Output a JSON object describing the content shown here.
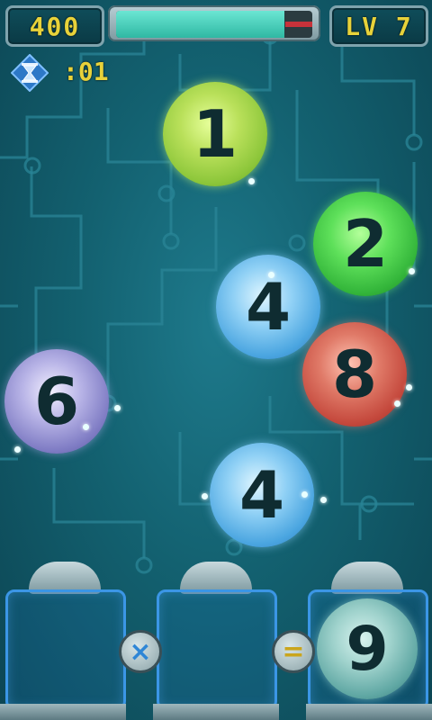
{
  "hud": {
    "score": "400",
    "level": "LV 7",
    "progress_fraction": 0.86
  },
  "timer": {
    "label": ":01",
    "icon": "hourglass-icon"
  },
  "bubbles": [
    {
      "number": "1",
      "color": "lime"
    },
    {
      "number": "2",
      "color": "green"
    },
    {
      "number": "4",
      "color": "blue"
    },
    {
      "number": "8",
      "color": "red"
    },
    {
      "number": "6",
      "color": "purple"
    },
    {
      "number": "4",
      "color": "blue"
    }
  ],
  "equation": {
    "operator_multiply": "×",
    "operator_equals": "=",
    "result": "9"
  },
  "colors": {
    "accent_text": "#e8d23a",
    "slot_border": "#3b96e6"
  }
}
